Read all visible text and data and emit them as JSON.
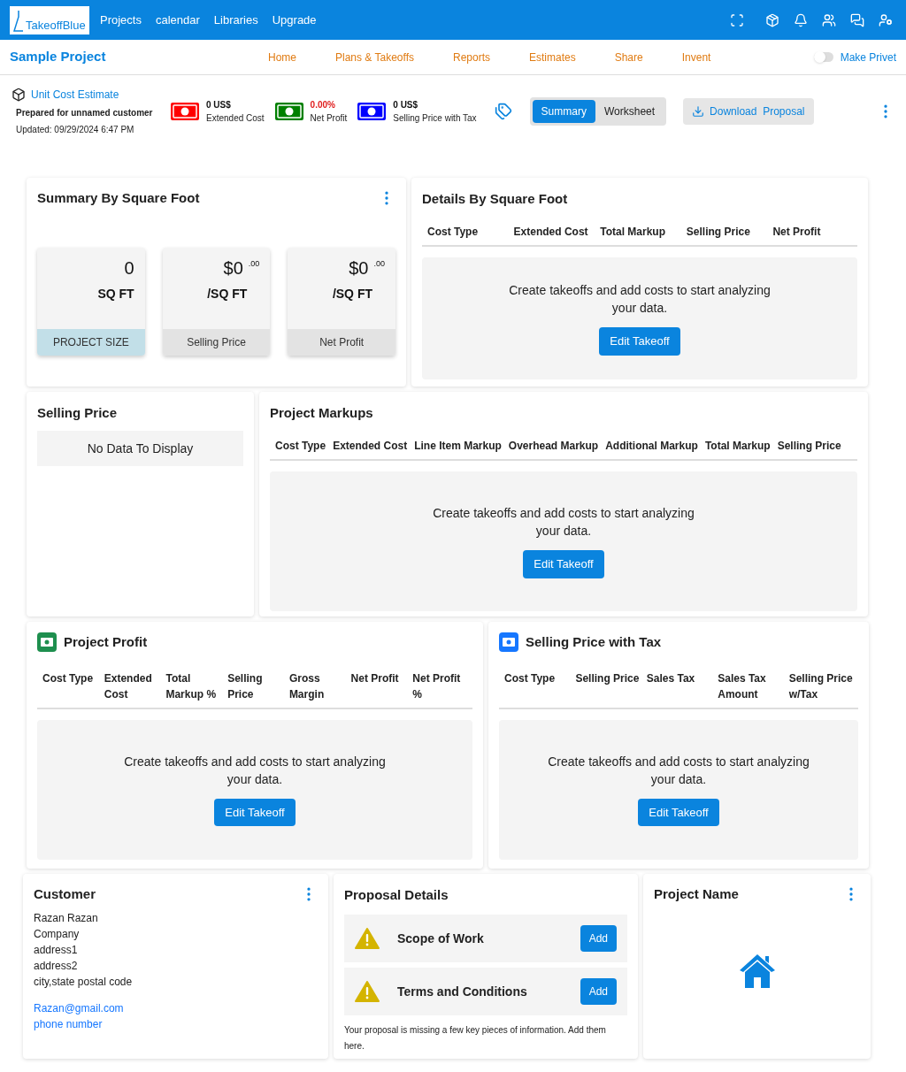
{
  "top_bar": {
    "logo": "TakeoffBlue",
    "menu": [
      "Projects",
      "calendar",
      "Libraries",
      "Upgrade"
    ]
  },
  "project_bar": {
    "title": "Sample Project",
    "tabs": [
      "Home",
      "Plans & Takeoffs",
      "Reports",
      "Estimates",
      "Share",
      "Invent"
    ],
    "privacy_toggle": {
      "label": "Make Privet",
      "on": false
    }
  },
  "estimate_header": {
    "title": "Unit Cost Estimate",
    "prepared_for": "Prepared for unnamed customer",
    "updated": "Updated: 09/29/2024 6:47 PM",
    "stats": [
      {
        "value": "0 US$",
        "label": "Extended Cost",
        "color": "#ff0000",
        "highlight": false
      },
      {
        "value": "0.00%",
        "label": "Net Profit",
        "color": "#008000",
        "highlight": true
      },
      {
        "value": "0 US$",
        "label": "Selling Price with Tax",
        "color": "#0000ff",
        "highlight": false
      }
    ],
    "views": [
      {
        "label": "Summary",
        "selected": true
      },
      {
        "label": "Worksheet",
        "selected": false
      }
    ],
    "download_button": "Download  Proposal"
  },
  "summary_by_square_foot": {
    "title": "Summary By Square Foot",
    "tiles": [
      {
        "value": "0",
        "unit": "SQ FT",
        "label": "PROJECT SIZE",
        "kind": "size"
      },
      {
        "value": "$0",
        "cents": ".00",
        "unit": "/SQ FT",
        "label": "Selling Price",
        "kind": "price"
      },
      {
        "value": "$0",
        "cents": ".00",
        "unit": "/SQ FT",
        "label": "Net Profit",
        "kind": "price"
      }
    ]
  },
  "details_by_square_foot": {
    "title": "Details By Square Foot",
    "columns": [
      "Cost Type",
      "Extended Cost",
      "Total Markup",
      "Selling Price",
      "Net Profit"
    ],
    "empty_message": "Create takeoffs and add costs to start analyzing your data.",
    "button": "Edit Takeoff"
  },
  "selling_price": {
    "title": "Selling Price",
    "empty_message": "No Data To Display"
  },
  "project_markups": {
    "title": "Project Markups",
    "columns": [
      "Cost Type",
      "Extended Cost",
      "Line Item Markup",
      "Overhead Markup",
      "Additional Markup",
      "Total Markup",
      "Selling Price"
    ],
    "empty_message": "Create takeoffs and add costs to start analyzing your data.",
    "button": "Edit Takeoff"
  },
  "project_profit": {
    "title": "Project Profit",
    "columns": [
      "Cost Type",
      "Extended Cost",
      "Total Markup %",
      "Selling Price",
      "Gross Margin",
      "Net Profit",
      "Net Profit %"
    ],
    "empty_message": "Create takeoffs and add costs to start analyzing your data.",
    "button": "Edit Takeoff"
  },
  "selling_price_with_tax": {
    "title": "Selling Price with Tax",
    "columns": [
      "Cost Type",
      "Selling Price",
      "Sales Tax",
      "Sales Tax Amount",
      "Selling Price w/Tax"
    ],
    "empty_message": "Create takeoffs and add costs to start analyzing your data.",
    "button": "Edit Takeoff"
  },
  "customer": {
    "title": "Customer",
    "lines": [
      "Razan Razan",
      "Company",
      "address1",
      "address2",
      "city,state postal code"
    ],
    "email": "Razan@gmail.com",
    "phone": "phone number"
  },
  "proposal_details": {
    "title": "Proposal Details",
    "items": [
      {
        "label": "Scope of Work",
        "button": "Add"
      },
      {
        "label": "Terms and Conditions",
        "button": "Add"
      }
    ],
    "note": "Your proposal is missing a few key pieces of information. Add them here."
  },
  "project_name": {
    "title": "Project Name"
  }
}
